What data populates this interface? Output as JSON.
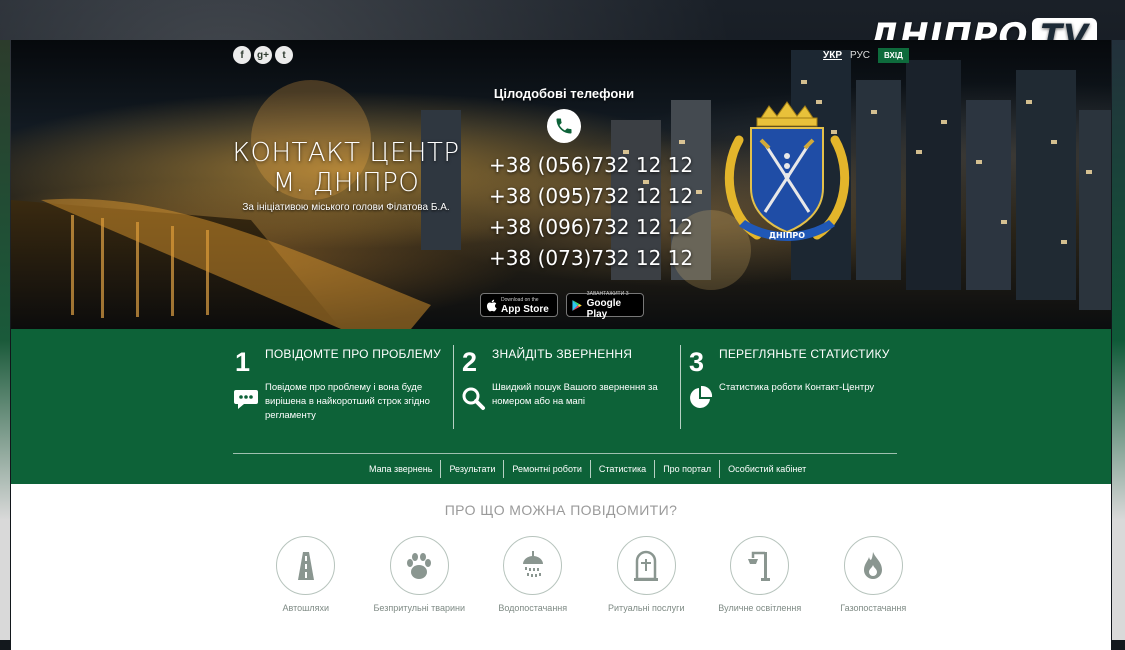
{
  "channel_logo": {
    "name": "ДНІПРО",
    "tv": "TV"
  },
  "social": [
    {
      "icon": "facebook-icon",
      "glyph": "f"
    },
    {
      "icon": "google-plus-icon",
      "glyph": "g+"
    },
    {
      "icon": "twitter-icon",
      "glyph": "t"
    }
  ],
  "lang": {
    "ukr": "УКР",
    "rus": "РУС",
    "login": "ВХІД"
  },
  "hero": {
    "title_line1": "КОНТАКТ ЦЕНТР",
    "title_line2": "М. ДНІПРО",
    "subtitle": "За ініціативою міського голови Філатова Б.А.",
    "phones_title": "Цілодобові телефони",
    "phones": [
      "+38 (056)732 12 12",
      "+38 (095)732 12 12",
      "+38 (096)732 12 12",
      "+38 (073)732 12 12"
    ],
    "appstore_small": "Download on the",
    "appstore_big": "App Store",
    "googleplay_small": "ЗАВАНТАЖИТИ З",
    "googleplay_big": "Google Play"
  },
  "steps": [
    {
      "num": "1",
      "title": "ПОВІДОМТЕ ПРО ПРОБЛЕМУ",
      "desc": "Повідоме про проблему і вона буде вирішена в найкоротший строк згідно регламенту",
      "icon": "chat-icon"
    },
    {
      "num": "2",
      "title": "ЗНАЙДІТЬ ЗВЕРНЕННЯ",
      "desc": "Швидкий пошук Вашого звернення за номером або на мапі",
      "icon": "search-icon"
    },
    {
      "num": "3",
      "title": "ПЕРЕГЛЯНЬТЕ СТАТИСТИКУ",
      "desc": "Статистика роботи Контакт-Центру",
      "icon": "pie-chart-icon"
    }
  ],
  "nav": [
    "Мапа звернень",
    "Результати",
    "Ремонтні роботи",
    "Статистика",
    "Про портал",
    "Особистий кабінет"
  ],
  "categories_heading": "ПРО ЩО МОЖНА ПОВІДОМИТИ?",
  "categories": [
    {
      "label": "Автошляхи",
      "icon": "road-icon"
    },
    {
      "label": "Безпритульні тварини",
      "icon": "paw-icon"
    },
    {
      "label": "Водопостачання",
      "icon": "shower-icon"
    },
    {
      "label": "Ритуальні послуги",
      "icon": "gravestone-icon"
    },
    {
      "label": "Вуличне освітлення",
      "icon": "street-lamp-icon"
    },
    {
      "label": "Газопостачання",
      "icon": "gas-flame-icon"
    }
  ],
  "colors": {
    "brand_green": "#0d6238",
    "icon_gray": "#8a9690"
  }
}
